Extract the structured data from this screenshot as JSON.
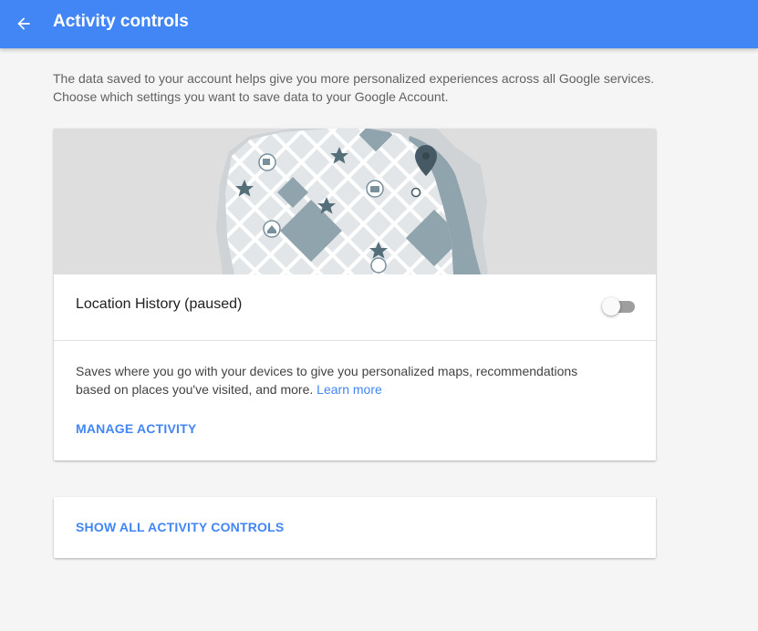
{
  "header": {
    "title": "Activity controls",
    "bg_color": "#4285f4",
    "back_icon": "arrow-back-icon"
  },
  "intro": {
    "line1": "The data saved to your account helps give you more personalized experiences across all Google services.",
    "line2": "Choose which settings you want to save data to your Google Account."
  },
  "location_card": {
    "illustration": "map-illustration",
    "title": "Location History (paused)",
    "toggle_on": false,
    "description": "Saves where you go with your devices to give you personalized maps, recommendations based on places you've visited, and more.",
    "learn_more": "Learn more",
    "manage_label": "MANAGE ACTIVITY"
  },
  "all_controls": {
    "label": "SHOW ALL ACTIVITY CONTROLS"
  },
  "colors": {
    "accent": "#4285f4",
    "map_water": "#90a4ae",
    "map_pin": "#455a64"
  }
}
